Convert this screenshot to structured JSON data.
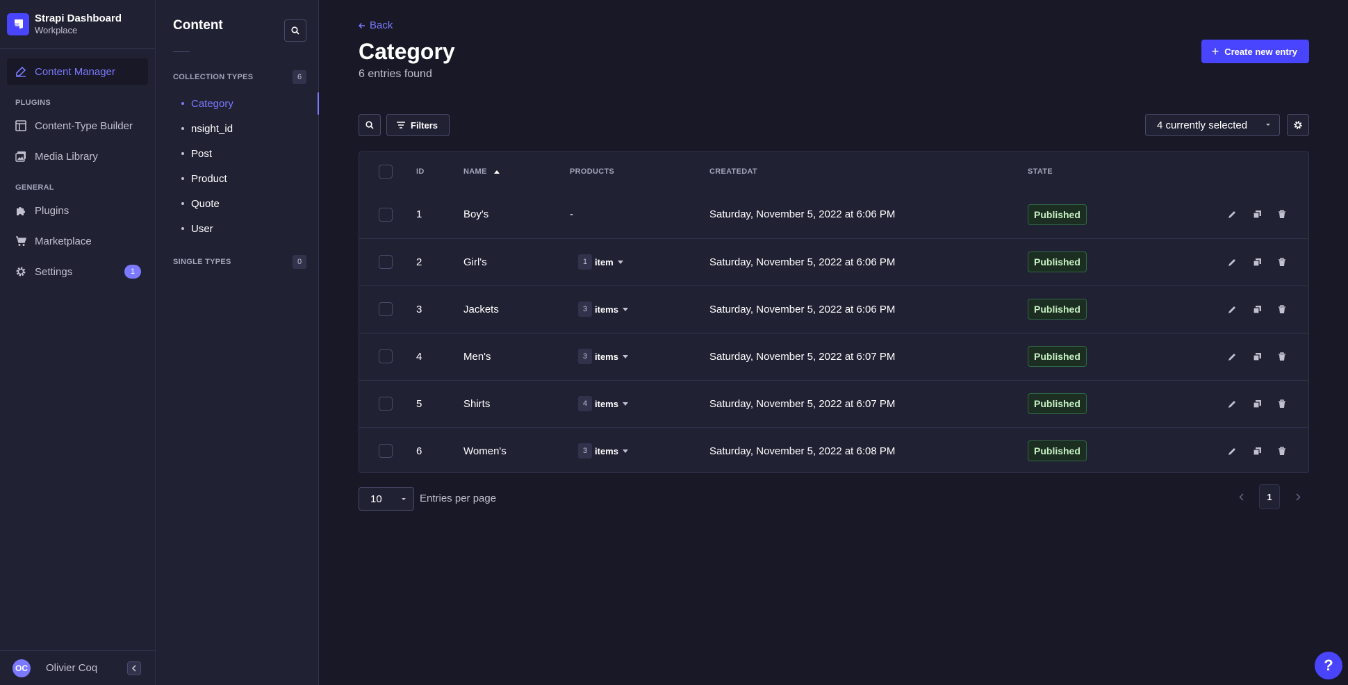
{
  "brand": {
    "title": "Strapi Dashboard",
    "subtitle": "Workplace"
  },
  "nav": {
    "content_manager": "Content Manager",
    "plugins_section": "PLUGINS",
    "content_type_builder": "Content-Type Builder",
    "media_library": "Media Library",
    "general_section": "GENERAL",
    "plugins": "Plugins",
    "marketplace": "Marketplace",
    "settings": "Settings",
    "settings_badge": "1"
  },
  "user": {
    "initials": "OC",
    "name": "Olivier Coq"
  },
  "subnav": {
    "title": "Content",
    "collection_label": "COLLECTION TYPES",
    "collection_count": "6",
    "items": [
      "Category",
      "nsight_id",
      "Post",
      "Product",
      "Quote",
      "User"
    ],
    "single_label": "SINGLE TYPES",
    "single_count": "0"
  },
  "page": {
    "back": "Back",
    "title": "Category",
    "subtitle": "6 entries found",
    "create_button": "Create new entry",
    "filters": "Filters",
    "columns_selected": "4 currently selected"
  },
  "table": {
    "headers": {
      "id": "ID",
      "name": "NAME",
      "products": "PRODUCTS",
      "createdat": "CREATEDAT",
      "state": "STATE"
    },
    "rows": [
      {
        "id": "1",
        "name": "Boy's",
        "products_count": "",
        "products_label": "-",
        "createdat": "Saturday, November 5, 2022 at 6:06 PM",
        "state": "Published"
      },
      {
        "id": "2",
        "name": "Girl's",
        "products_count": "1",
        "products_label": "item",
        "createdat": "Saturday, November 5, 2022 at 6:06 PM",
        "state": "Published"
      },
      {
        "id": "3",
        "name": "Jackets",
        "products_count": "3",
        "products_label": "items",
        "createdat": "Saturday, November 5, 2022 at 6:06 PM",
        "state": "Published"
      },
      {
        "id": "4",
        "name": "Men's",
        "products_count": "3",
        "products_label": "items",
        "createdat": "Saturday, November 5, 2022 at 6:07 PM",
        "state": "Published"
      },
      {
        "id": "5",
        "name": "Shirts",
        "products_count": "4",
        "products_label": "items",
        "createdat": "Saturday, November 5, 2022 at 6:07 PM",
        "state": "Published"
      },
      {
        "id": "6",
        "name": "Women's",
        "products_count": "3",
        "products_label": "items",
        "createdat": "Saturday, November 5, 2022 at 6:08 PM",
        "state": "Published"
      }
    ]
  },
  "pagination": {
    "per_page": "10",
    "per_page_label": "Entries per page",
    "current_page": "1"
  },
  "help": "?",
  "colors": {
    "accent": "#4945ff",
    "accent_text": "#7b79ff",
    "success_text": "#c6f0c2",
    "background": "#181826",
    "surface": "#212134"
  }
}
